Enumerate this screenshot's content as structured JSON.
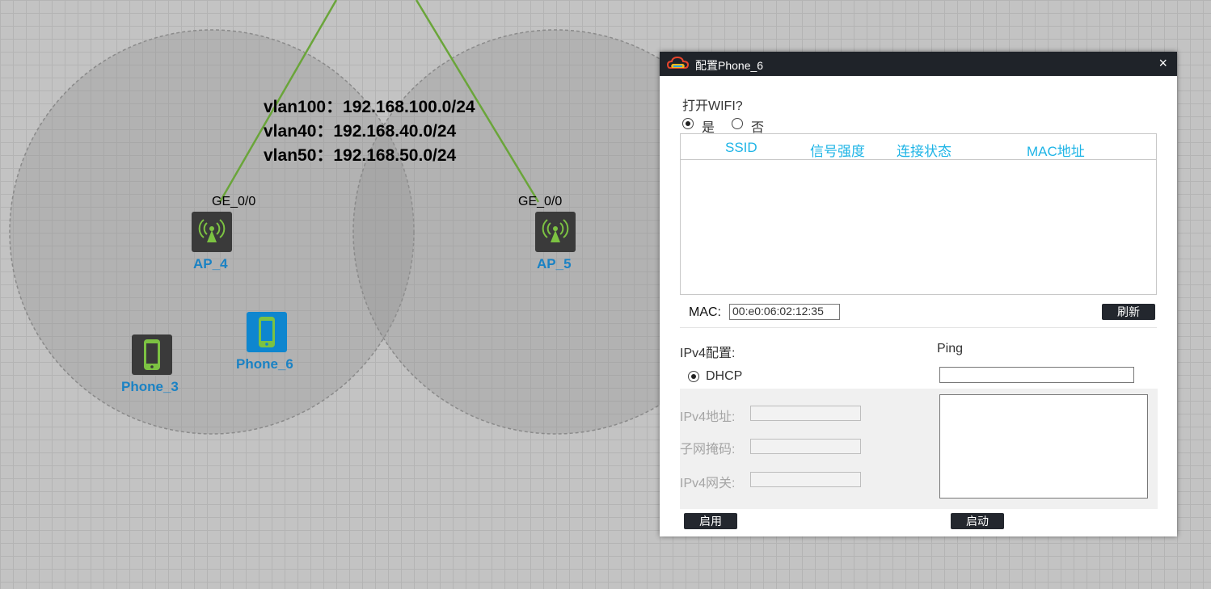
{
  "topology": {
    "annotations": [
      "vlan100：192.168.100.0/24",
      "vlan40：192.168.40.0/24",
      "vlan50：192.168.50.0/24"
    ],
    "ap_left": {
      "name": "AP_4",
      "port": "GE_0/0"
    },
    "ap_right": {
      "name": "AP_5",
      "port": "GE_0/0"
    },
    "phone_a": {
      "name": "Phone_3"
    },
    "phone_b": {
      "name": "Phone_6"
    },
    "colors": {
      "link": "#6aa53a",
      "label": "#1a82c4",
      "device_dark": "#3a3a3a",
      "device_selected": "#0e86cf",
      "wifi_icon": "#7cc242"
    }
  },
  "dialog": {
    "title": "配置Phone_6",
    "close_icon": "×",
    "wifi_question": "打开WIFI?",
    "wifi_yes": "是",
    "wifi_no": "否",
    "wifi_selected": "是",
    "table_headers": [
      "SSID",
      "信号强度",
      "连接状态",
      "MAC地址"
    ],
    "table_rows": [],
    "mac_label": "MAC:",
    "mac_value": "00:e0:06:02:12:35",
    "refresh_button": "刷新",
    "ipv4_config_label": "IPv4配置:",
    "dhcp_label": "DHCP",
    "ipv4_addr_label": "IPv4地址:",
    "subnet_label": "子网掩码:",
    "gateway_label": "IPv4网关:",
    "apply_button": "启用",
    "ping_label": "Ping",
    "ping_input_value": "",
    "start_button": "启动",
    "colors": {
      "titlebar": "#1f2329",
      "table_header_text": "#1eb4e6",
      "button": "#23272e"
    }
  }
}
